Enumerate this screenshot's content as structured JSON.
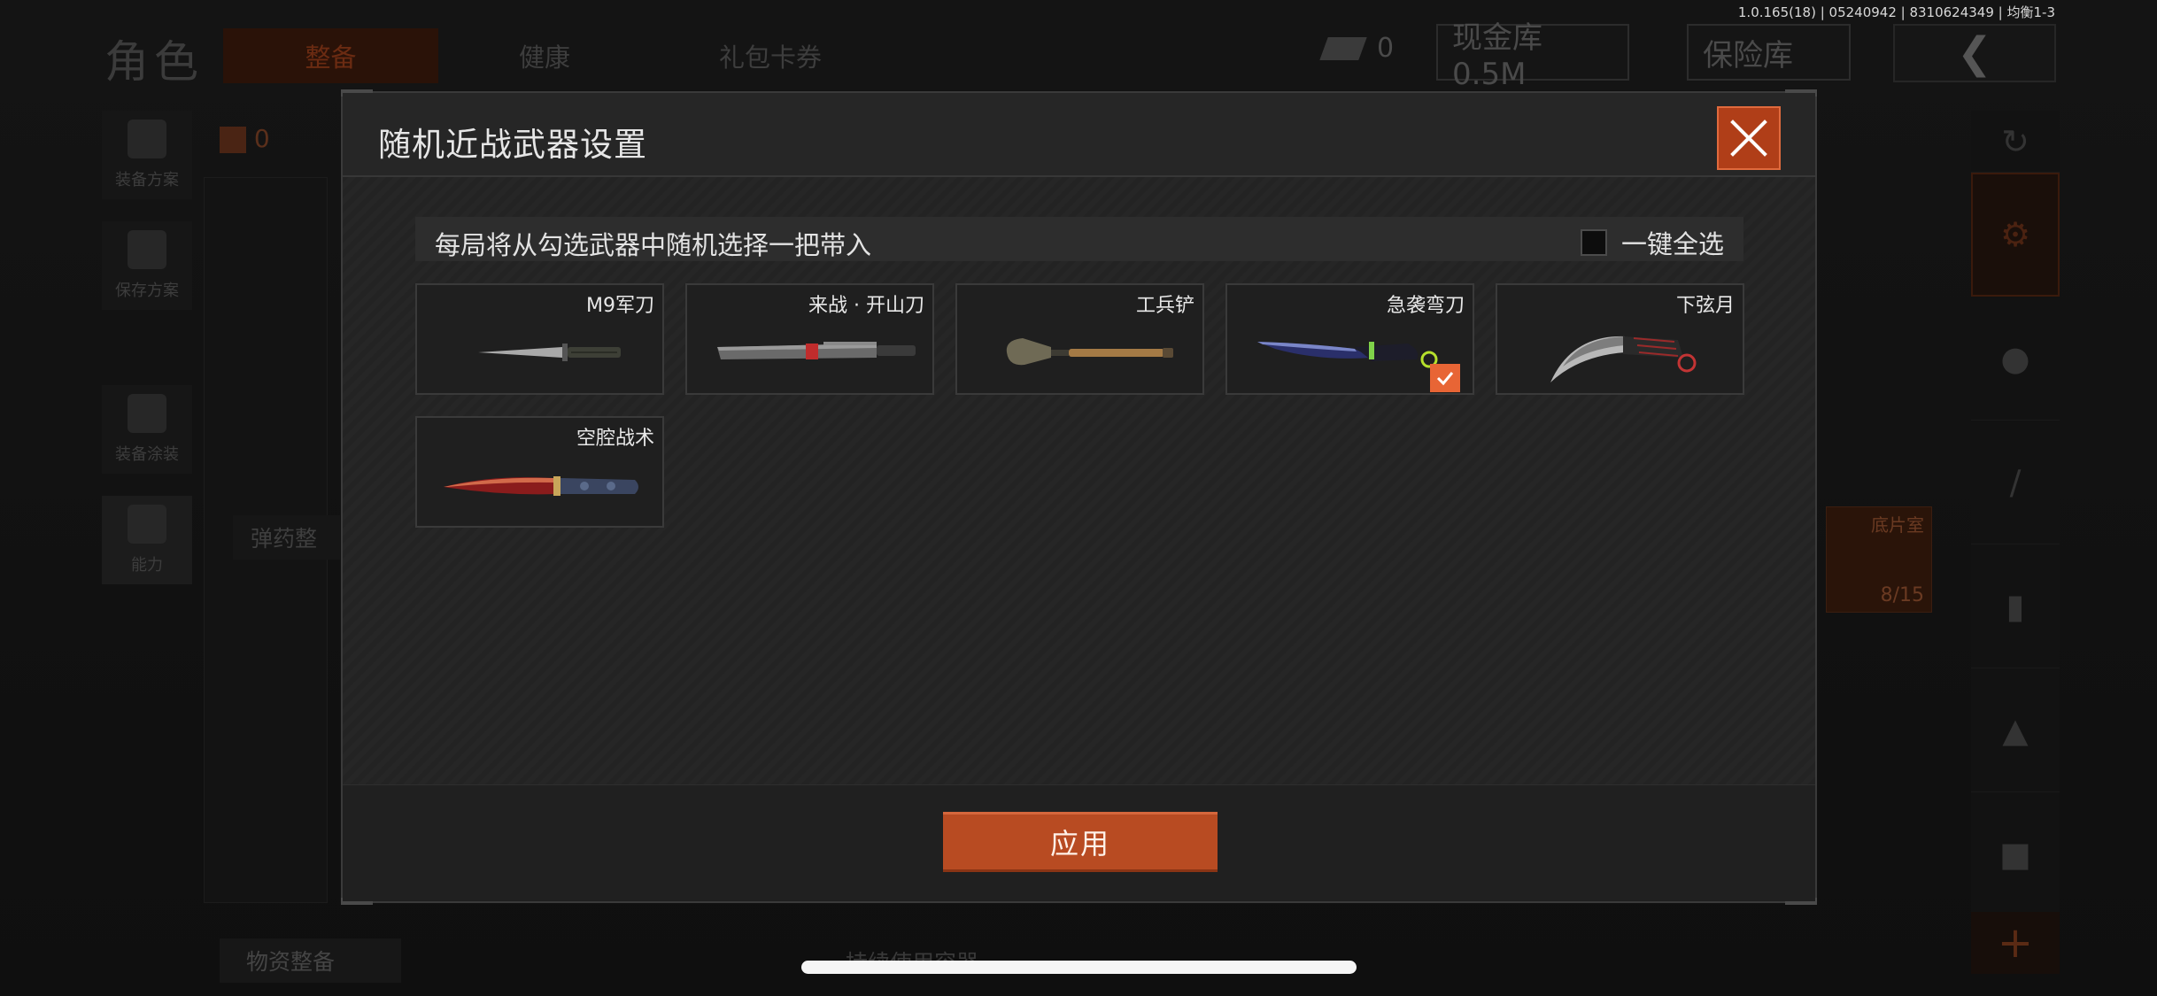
{
  "version_info": "1.0.165(18) | 05240942 | 8310624349 | 均衡1-3",
  "background": {
    "page_title": "角色",
    "tabs": [
      {
        "label": "整备",
        "active": true
      },
      {
        "label": "健康",
        "active": false
      },
      {
        "label": "礼包卡券",
        "active": false
      }
    ],
    "bill_count": "0",
    "cash_storage": "现金库 0.5M",
    "safe_storage": "保险库",
    "left_rail": [
      "装备方案",
      "保存方案",
      "装备涂装",
      "能力"
    ],
    "backpack_count": "0",
    "ammo_label": "弹药整",
    "supply_label": "物资整备",
    "container_label": "持续使用容器",
    "shard_card": {
      "label": "底片室",
      "count": "8/15"
    }
  },
  "modal": {
    "title": "随机近战武器设置",
    "info_text": "每局将从勾选武器中随机选择一把带入",
    "select_all_label": "一键全选",
    "select_all_checked": false,
    "weapons": [
      {
        "name": "M9军刀",
        "art": "m9-bayonet-icon",
        "selected": false
      },
      {
        "name": "来战 · 开山刀",
        "art": "machete-icon",
        "selected": false
      },
      {
        "name": "工兵铲",
        "art": "shovel-icon",
        "selected": false
      },
      {
        "name": "急袭弯刀",
        "art": "raid-scimitar-icon",
        "selected": true
      },
      {
        "name": "下弦月",
        "art": "karambit-icon",
        "selected": false
      },
      {
        "name": "空腔战术",
        "art": "tactical-knife-icon",
        "selected": false
      }
    ],
    "apply_label": "应用"
  },
  "colors": {
    "accent": "#e86535",
    "apply_button": "#b84b22",
    "close_button": "#b03e18"
  }
}
